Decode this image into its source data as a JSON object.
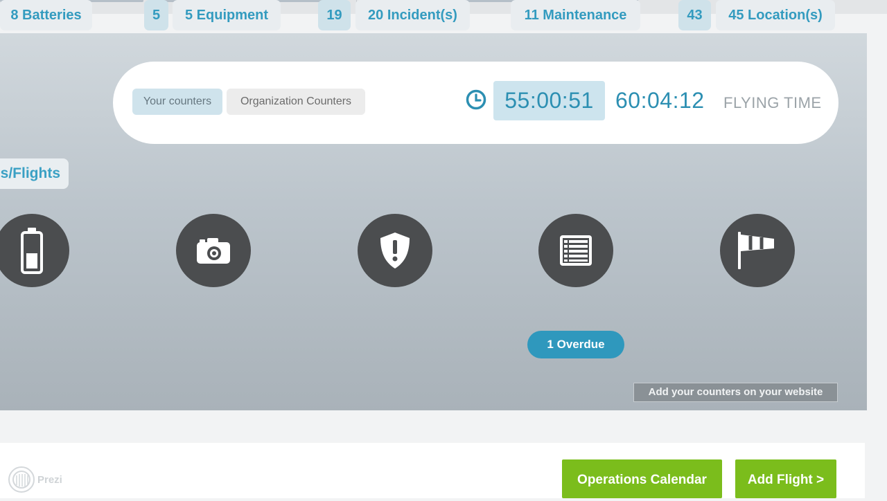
{
  "counters": {
    "tabs": [
      "Your counters",
      "Organization Counters"
    ],
    "times": [
      "55:00:51",
      "60:04:12"
    ],
    "time_label": "FLYING TIME"
  },
  "section_tab": "s/Flights",
  "items": [
    {
      "icon": "battery-icon",
      "chips": [
        "8 Batteries"
      ]
    },
    {
      "icon": "camera-icon",
      "chips": [
        "5",
        "5 Equipment"
      ]
    },
    {
      "icon": "shield-alert-icon",
      "chips": [
        "19",
        "20 Incident(s)"
      ]
    },
    {
      "icon": "list-icon",
      "chips": [
        "11 Maintenance"
      ],
      "badge": "1 Overdue"
    },
    {
      "icon": "windsock-icon",
      "chips": [
        "43",
        "45 Location(s)"
      ]
    }
  ],
  "add_counters_link": "Add your counters on your website",
  "buttons": {
    "operations_calendar": "Operations Calendar",
    "add_flight": "Add Flight >"
  },
  "watermark": "Prezi",
  "colors": {
    "accent_blue": "#339bbf",
    "green_button": "#7bbd1c",
    "icon_circle": "#4b4d4f"
  }
}
